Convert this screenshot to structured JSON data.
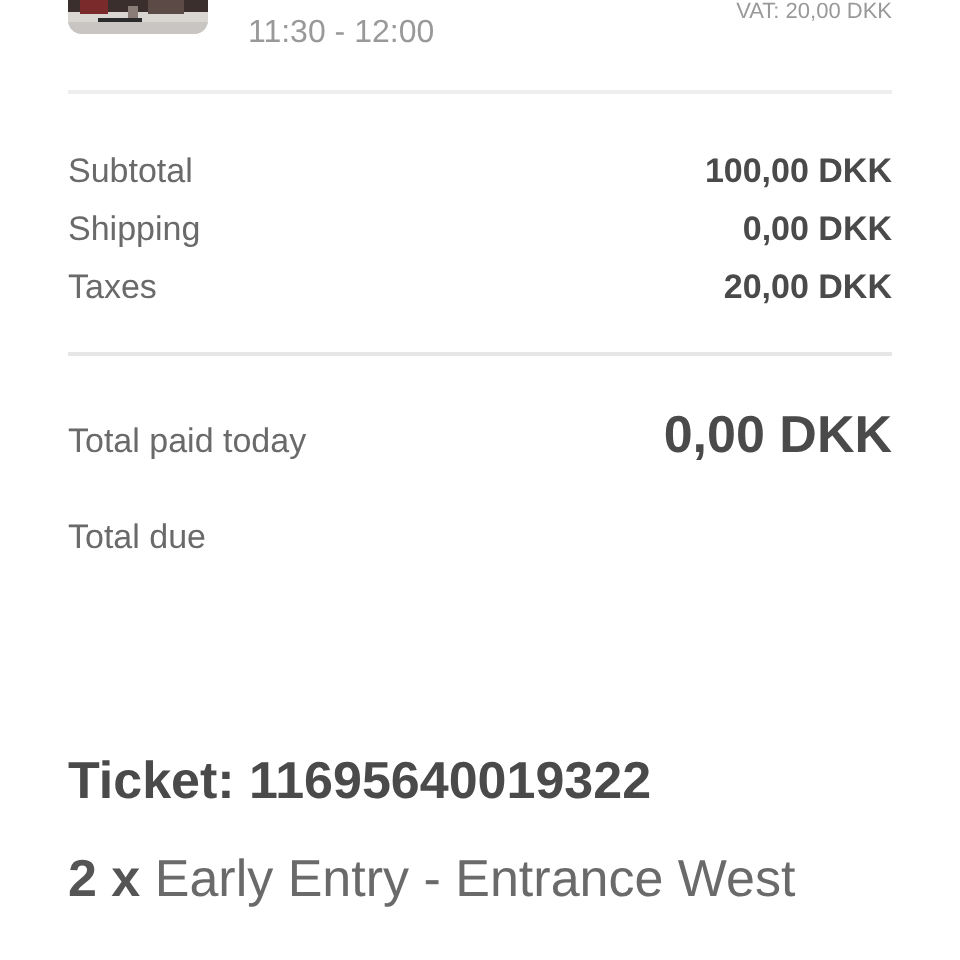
{
  "item": {
    "vat": "VAT: 20,00 DKK",
    "time": "11:30 - 12:00"
  },
  "summary": [
    {
      "label": "Subtotal",
      "value": "100,00 DKK"
    },
    {
      "label": "Shipping",
      "value": "0,00 DKK"
    },
    {
      "label": "Taxes",
      "value": "20,00 DKK"
    }
  ],
  "total_paid": {
    "label": "Total paid today",
    "value": "0,00 DKK"
  },
  "total_due": {
    "label": "Total due"
  },
  "ticket": {
    "title": "Ticket: 11695640019322",
    "line": "**2 x** Early Entry - Entrance West"
  }
}
